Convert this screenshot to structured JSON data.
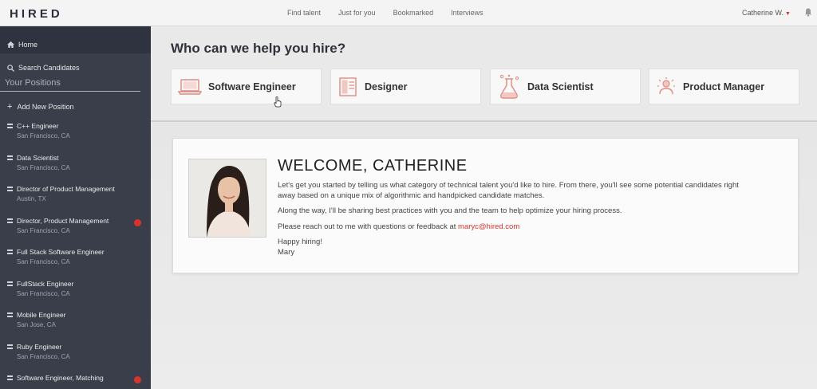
{
  "app": {
    "logo": "HIRED"
  },
  "topnav": {
    "items": [
      "Find talent",
      "Just for you",
      "Bookmarked",
      "Interviews"
    ],
    "user": "Catherine W."
  },
  "sidebar": {
    "home": "Home",
    "search": "Search Candidates",
    "positions_title": "Your Positions",
    "add_new": "Add New Position",
    "positions": [
      {
        "title": "C++ Engineer",
        "location": "San Francisco, CA",
        "alert": false
      },
      {
        "title": "Data Scientist",
        "location": "San Francisco, CA",
        "alert": false
      },
      {
        "title": "Director of Product Management",
        "location": "Austin, TX",
        "alert": false
      },
      {
        "title": "Director, Product Management",
        "location": "San Francisco, CA",
        "alert": true
      },
      {
        "title": "Full Stack Software Engineer",
        "location": "San Francisco, CA",
        "alert": false
      },
      {
        "title": "FullStack Engineer",
        "location": "San Francisco, CA",
        "alert": false
      },
      {
        "title": "Mobile Engineer",
        "location": "San Jose, CA",
        "alert": false
      },
      {
        "title": "Ruby Engineer",
        "location": "San Francisco, CA",
        "alert": false
      },
      {
        "title": "Software Engineer, Matching",
        "location": "",
        "alert": true
      }
    ]
  },
  "hire": {
    "title": "Who can we help you hire?",
    "categories": [
      {
        "label": "Software Engineer",
        "icon": "laptop-icon"
      },
      {
        "label": "Designer",
        "icon": "designer-icon"
      },
      {
        "label": "Data Scientist",
        "icon": "flask-icon"
      },
      {
        "label": "Product Manager",
        "icon": "product-manager-icon"
      }
    ]
  },
  "welcome": {
    "title": "WELCOME, CATHERINE",
    "p1": "Let's get you started by telling us what category of technical talent you'd like to hire. From there, you'll see some potential candidates right away based on a unique mix of algorithmic and handpicked candidate matches.",
    "p2": "Along the way, I'll be sharing best practices with you and the team to help optimize your hiring process.",
    "p3_prefix": "Please reach out to me with questions or feedback at ",
    "email": "maryc@hired.com",
    "signoff_line1": "Happy hiring!",
    "signoff_line2": "Mary"
  },
  "colors": {
    "accent": "#d9342b",
    "sidebar": "#3a3e4b",
    "sidebar_dark": "#2f333f"
  }
}
